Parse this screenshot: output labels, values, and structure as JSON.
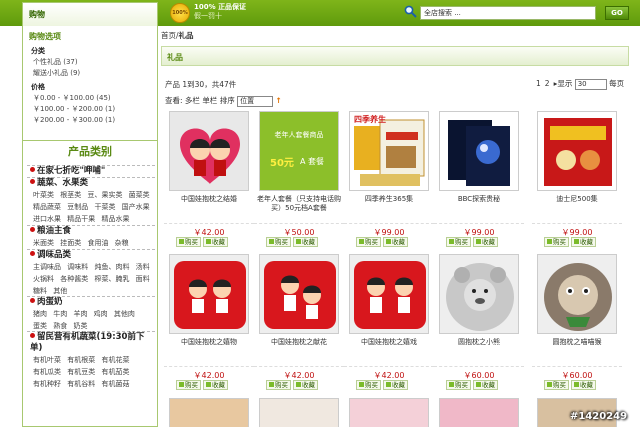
{
  "header": {
    "cart_label": "购物",
    "badge_text": "100%",
    "guarantee_line1": "100% 正品保证",
    "guarantee_line2": "假一罚十",
    "search_placeholder": "全店搜索 ...",
    "go_label": "GO"
  },
  "sidebar": {
    "options_title": "购物选项",
    "category_group": "分类",
    "category_items": [
      "个性礼品 (37)",
      "耀送小礼品 (9)"
    ],
    "price_group": "价格",
    "price_items": [
      "￥0.00 - ￥100.00 (45)",
      "￥100.00 - ￥200.00 (1)",
      "￥200.00 - ￥300.00 (1)"
    ],
    "product_category_title": "产品类别",
    "categories": [
      {
        "head": "在家七折吃\"呷哺\"",
        "subs": []
      },
      {
        "head": "蔬菜、水果类",
        "subs": [
          "叶菜类 根茎类 豆、果实类 菌菜类",
          "精品蔬菜 豆制品 干菜类 国产水果",
          "进口水果 精品干果 精品水果"
        ]
      },
      {
        "head": "粮油主食",
        "subs": [
          "米面类 挂面类 食用油 杂粮"
        ]
      },
      {
        "head": "调味品类",
        "subs": [
          "主调味品 调味料 炖鱼、肉料 汤料",
          "火锅料 各种酱类 榨菜、腌乳 面料",
          "糖料 其他"
        ]
      },
      {
        "head": "肉蛋奶",
        "subs": [
          "猪肉 牛肉 羊肉 鸡肉 其他肉",
          "蛋类 熟食 奶类"
        ]
      },
      {
        "head": "留民营有机蔬菜(19:30前下单)",
        "subs": [
          "有机叶菜 有机根菜 有机花菜",
          "有机瓜类 有机豆类 有机茄类",
          "有机种籽 有机谷料 有机菌菇"
        ]
      }
    ]
  },
  "breadcrumb": {
    "home": "首页",
    "sep": "/",
    "current": "礼品"
  },
  "section_title": "礼品",
  "listing": {
    "count_text": "产品 1到30，共47件",
    "pages": [
      "1",
      "2"
    ],
    "next_arrow": "▸",
    "show_label": "显示",
    "per_page": "30",
    "per_page_suffix": "每页",
    "view_label": "查看: 多栏",
    "view_single": "单栏",
    "sort_label": "排序",
    "sort_value": "位置",
    "sort_arrow": "↑"
  },
  "buy_label": "购买",
  "fav_label": "收藏",
  "products": [
    {
      "name": "中国娃抱枕之结婚",
      "price": "￥42.00"
    },
    {
      "name": "老年人套餐（只支持电话购买）50元档A套餐",
      "price": "￥50.00"
    },
    {
      "name": "四季养生365集",
      "price": "￥99.00"
    },
    {
      "name": "BBC探索贵秘",
      "price": "￥99.00"
    },
    {
      "name": "迪士尼500集",
      "price": "￥99.00"
    },
    {
      "name": "中国娃抱枕之嬉物",
      "price": "￥42.00"
    },
    {
      "name": "中国娃抱枕之献花",
      "price": "￥42.00"
    },
    {
      "name": "中国娃抱枕之嬉戏",
      "price": "￥42.00"
    },
    {
      "name": "圆抱枕之小熊",
      "price": "￥60.00"
    },
    {
      "name": "圆抱枕之喵喵猴",
      "price": "￥60.00"
    }
  ],
  "banner_text": {
    "line1": "老年人套餐商品",
    "line2": "50元",
    "line3": "A 套餐"
  },
  "box_label": "四季养生",
  "watermark": "#1420249",
  "colors": {
    "accent_green": "#5f9a0c",
    "price_red": "#c01010",
    "thumb_red": "#d8171d"
  }
}
